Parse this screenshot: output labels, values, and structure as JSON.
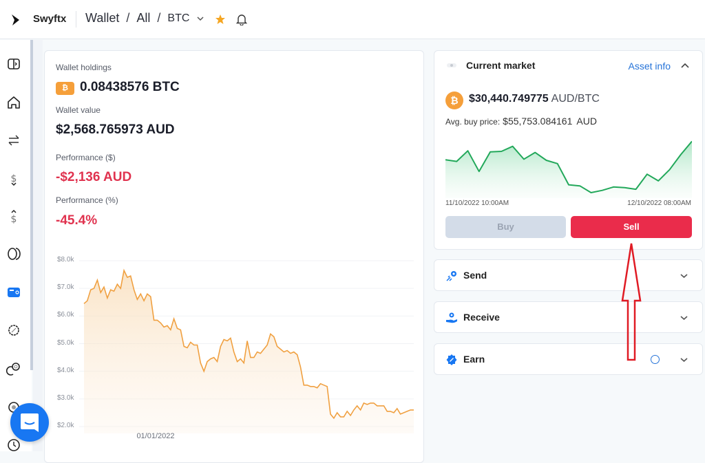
{
  "topbar": {
    "brand": "Swyftx",
    "breadcrumb": [
      "Wallet",
      "All",
      "BTC"
    ],
    "icons": [
      "swyftx-logo-icon",
      "chevron-down-icon",
      "star-icon",
      "bell-icon"
    ]
  },
  "sidebar": {
    "items": [
      {
        "icon": "sidebar-toggle-icon",
        "active": false
      },
      {
        "icon": "home-icon",
        "active": false
      },
      {
        "icon": "swap-icon",
        "active": false
      },
      {
        "icon": "deposit-icon",
        "active": false
      },
      {
        "icon": "withdraw-icon",
        "active": false
      },
      {
        "icon": "assets-icon",
        "active": false
      },
      {
        "icon": "wallet-icon",
        "active": true
      },
      {
        "icon": "explore-icon",
        "active": false
      },
      {
        "icon": "earn-icon",
        "active": false
      },
      {
        "icon": "settings-icon",
        "active": false
      },
      {
        "icon": "history-icon",
        "active": false
      }
    ]
  },
  "wallet": {
    "holdings_label": "Wallet holdings",
    "holdings_value": "0.08438576 BTC",
    "coin_symbol": "₿",
    "value_label": "Wallet value",
    "value": "$2,568.765973 AUD",
    "perf_dollar_label": "Performance ($)",
    "perf_dollar": "-$2,136 AUD",
    "perf_pct_label": "Performance (%)",
    "perf_pct": "-45.4%"
  },
  "market": {
    "title": "Current market",
    "asset_info": "Asset info",
    "price": "$30,440.749775",
    "price_unit": "AUD/BTC",
    "avg_label": "Avg. buy price:",
    "avg_value": "$55,753.084161",
    "avg_unit": "AUD",
    "start_label": "11/10/2022 10:00AM",
    "end_label": "12/10/2022 08:00AM",
    "buy_label": "Buy",
    "sell_label": "Sell"
  },
  "accordions": [
    {
      "label": "Send",
      "icon": "send-icon"
    },
    {
      "label": "Receive",
      "icon": "receive-icon"
    },
    {
      "label": "Earn",
      "icon": "earn-badge-icon",
      "info": true
    }
  ],
  "colors": {
    "accent": "#2573d8",
    "negative": "#e0334f",
    "sell": "#ea2c4b",
    "buy_disabled": "#d3dce8",
    "btc": "#f59f3a",
    "wallet_line": "#f0a040",
    "market_line": "#22a85a",
    "annotation_arrow": "#e01b24"
  },
  "chart_data": [
    {
      "type": "area",
      "title": "Wallet value",
      "xlabel": "",
      "ylabel": "",
      "ylim": [
        2000,
        8000
      ],
      "yticks": [
        "$8.0k",
        "$7.0k",
        "$6.0k",
        "$5.0k",
        "$4.0k",
        "$3.0k",
        "$2.0k"
      ],
      "ytick_values": [
        8000,
        7000,
        6000,
        5000,
        4000,
        3000,
        2000
      ],
      "xticks": [
        "01/01/2022"
      ],
      "xtick_index": 22,
      "grid": true,
      "values": [
        6450,
        6550,
        6950,
        7000,
        7300,
        6850,
        7050,
        6650,
        6950,
        6900,
        7150,
        7000,
        7650,
        7400,
        7450,
        6950,
        6600,
        6800,
        6550,
        6800,
        6700,
        5850,
        5850,
        5750,
        5600,
        5650,
        5500,
        5900,
        5550,
        5500,
        4900,
        4850,
        5050,
        4950,
        4950,
        4300,
        4000,
        4350,
        4450,
        4500,
        4350,
        4900,
        5150,
        5100,
        5200,
        4700,
        4350,
        4450,
        4300,
        5100,
        4500,
        4500,
        4700,
        4650,
        4800,
        4950,
        5350,
        5250,
        4900,
        4800,
        4700,
        4750,
        4650,
        4700,
        4600,
        4150,
        3500,
        3500,
        3450,
        3450,
        3400,
        3550,
        3500,
        3450,
        2450,
        2300,
        2500,
        2350,
        2350,
        2550,
        2400,
        2600,
        2750,
        2600,
        2850,
        2800,
        2850,
        2850,
        2750,
        2750,
        2750,
        2550,
        2550,
        2500,
        2650,
        2450,
        2500,
        2550,
        2600,
        2600
      ]
    },
    {
      "type": "area",
      "title": "Current market BTC/AUD",
      "x_start": "11/10/2022 10:00AM",
      "x_end": "12/10/2022 08:00AM",
      "grid": false,
      "values": [
        0.64,
        0.61,
        0.8,
        0.43,
        0.78,
        0.79,
        0.88,
        0.65,
        0.77,
        0.63,
        0.57,
        0.19,
        0.17,
        0.05,
        0.09,
        0.15,
        0.14,
        0.11,
        0.38,
        0.26,
        0.46,
        0.73,
        0.97
      ]
    }
  ]
}
